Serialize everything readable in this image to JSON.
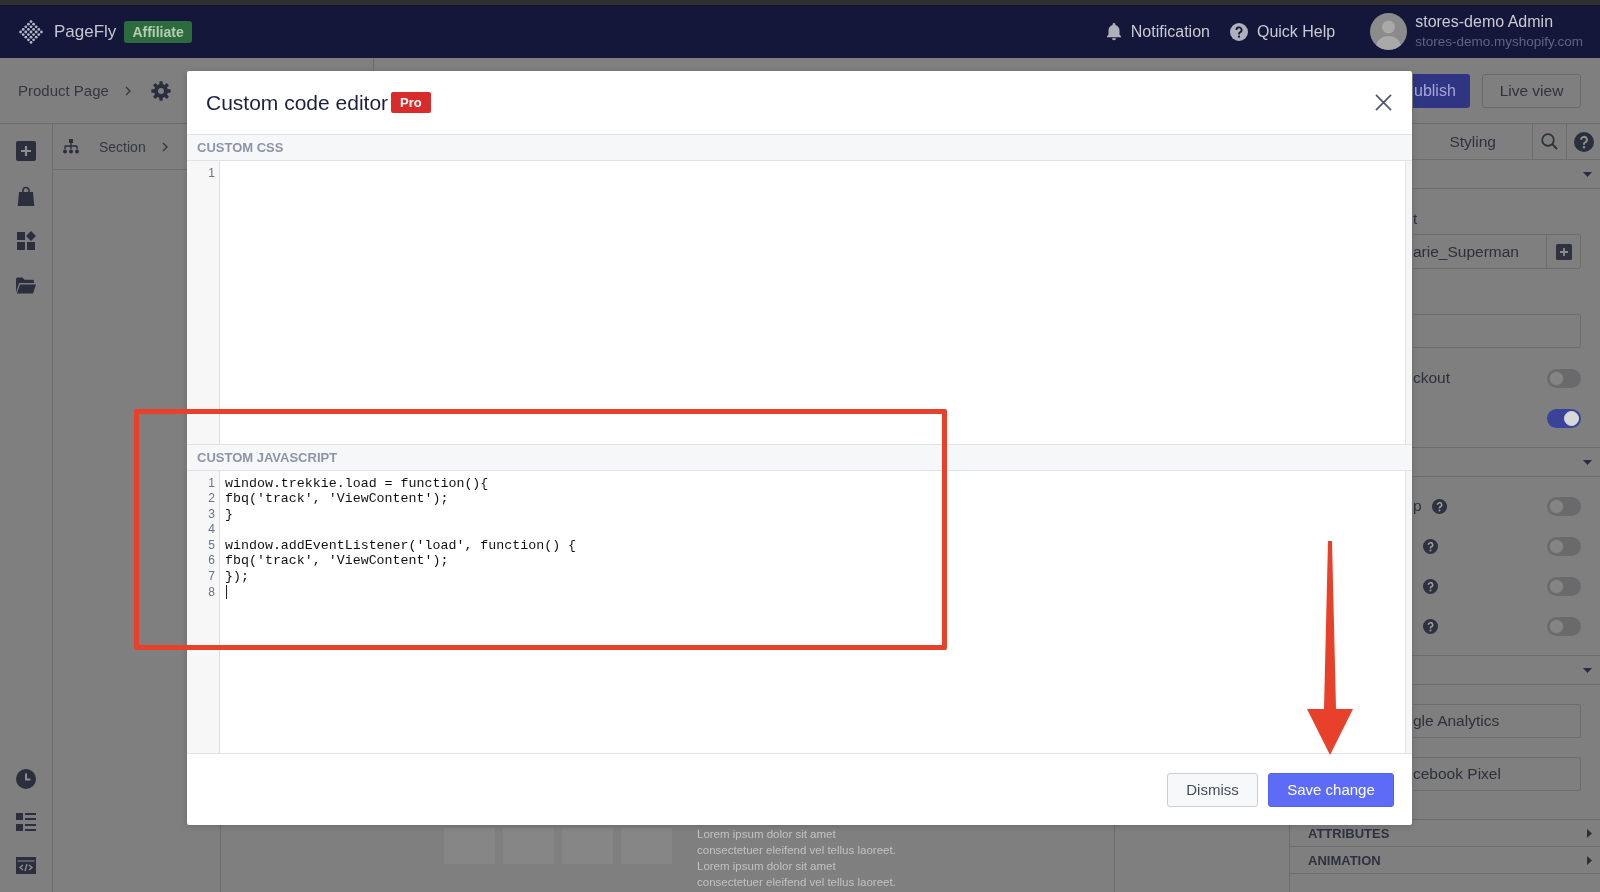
{
  "top_bar": {
    "logo": "PageFly",
    "badge": "Affiliate",
    "links": [
      {
        "kind": "notification",
        "label": "Notification"
      },
      {
        "kind": "help",
        "label": "Quick Help"
      }
    ],
    "user": {
      "name": "stores-demo Admin",
      "store": "stores-demo.myshopify.com"
    }
  },
  "toolbar": {
    "breadcrumb": "Product Page",
    "publish_button": "ublish",
    "live_view_button": "Live view"
  },
  "section_bar": {
    "breadcrumb": "Section"
  },
  "canvas": {
    "text_lines": [
      "Lorem ipsum dolor sit amet",
      "consectetuer eleifend vel tellus laoreet.",
      "Lorem ipsum dolor sit amet",
      "consectetuer eleifend vel tellus laoreet."
    ]
  },
  "right_panel": {
    "tabs": [
      {
        "label": "Styling"
      }
    ],
    "rows": [
      {
        "kind": "section",
        "expanded": true
      },
      {
        "kind": "label",
        "text": "t"
      },
      {
        "kind": "input_add",
        "value": "arie_Superman"
      },
      {
        "kind": "input"
      },
      {
        "kind": "toggle",
        "label": "ckout",
        "help": false,
        "on": false
      },
      {
        "kind": "toggle",
        "help": false,
        "on": true
      },
      {
        "kind": "section",
        "expanded": true
      },
      {
        "kind": "toggle",
        "label": "p",
        "help": true,
        "on": false
      },
      {
        "kind": "toggle",
        "help": true,
        "on": false
      },
      {
        "kind": "toggle",
        "help": true,
        "on": false
      },
      {
        "kind": "toggle",
        "help": true,
        "on": false
      },
      {
        "kind": "section",
        "expanded": true
      },
      {
        "kind": "button",
        "label": "gle Analytics"
      },
      {
        "kind": "button",
        "label": "cebook Pixel"
      },
      {
        "kind": "section",
        "title": "ATTRIBUTES",
        "expanded": false
      },
      {
        "kind": "section",
        "title": "ANIMATION",
        "expanded": false
      }
    ]
  },
  "modal": {
    "title": "Custom code editor",
    "badge": "Pro",
    "editors": [
      {
        "label": "CUSTOM CSS",
        "lines": [
          {
            "number": "1",
            "cursor": false
          }
        ]
      },
      {
        "label": "CUSTOM JAVASCRIPT",
        "lines": [
          {
            "number": "1",
            "code": "window.trekkie.load = function(){",
            "cursor": false
          },
          {
            "number": "2",
            "code": "fbq('track', 'ViewContent');",
            "cursor": false
          },
          {
            "number": "3",
            "code": "}",
            "cursor": false
          },
          {
            "number": "4",
            "cursor": false
          },
          {
            "number": "5",
            "code": "window.addEventListener('load', function() {",
            "cursor": false
          },
          {
            "number": "6",
            "code": "fbq('track', 'ViewContent');",
            "cursor": false
          },
          {
            "number": "7",
            "code": "});",
            "cursor": false
          },
          {
            "number": "8",
            "cursor": true
          }
        ]
      }
    ],
    "buttons": [
      {
        "kind": "secondary",
        "label": "Dismiss"
      },
      {
        "kind": "primary",
        "label": "Save change"
      }
    ]
  }
}
